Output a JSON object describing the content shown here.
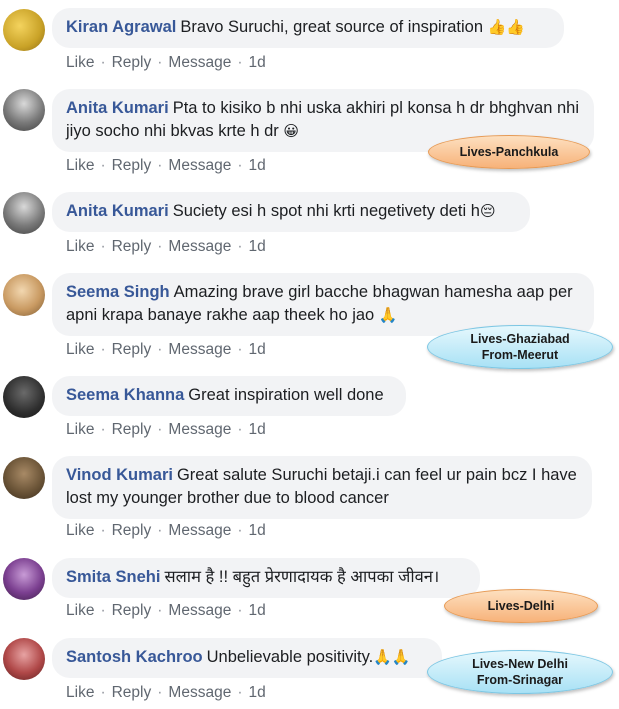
{
  "actions": {
    "like": "Like",
    "reply": "Reply",
    "message": "Message",
    "time": "1d",
    "sep": "·"
  },
  "comments": [
    {
      "author": "Kiran Agrawal",
      "text": "Bravo Suruchi, great source of inspiration",
      "emoji": "👍👍"
    },
    {
      "author": "Anita Kumari",
      "text": "Pta to kisiko b nhi uska akhiri pl konsa h dr bhghvan nhi jiyo socho nhi bkvas krte h dr",
      "emoji": "😀"
    },
    {
      "author": "Anita Kumari",
      "text": "Suciety esi h spot nhi krti negetivety deti h",
      "emoji": "😔"
    },
    {
      "author": "Seema Singh",
      "text": "Amazing brave girl bacche bhagwan hamesha aap per apni krapa banaye rakhe aap theek ho jao",
      "emoji": "🙏"
    },
    {
      "author": "Seema Khanna",
      "text": "Great inspiration well done",
      "emoji": ""
    },
    {
      "author": "Vinod Kumari",
      "text": "Great salute Suruchi betaji.i can feel ur pain bcz I have lost my younger brother due to blood cancer",
      "emoji": ""
    },
    {
      "author": "Smita Snehi",
      "text": "सलाम है !! बहुत प्रेरणादायक है आपका जीवन।",
      "emoji": ""
    },
    {
      "author": "Santosh Kachroo",
      "text": "Unbelievable positivity.",
      "emoji": "🙏🙏"
    }
  ],
  "callouts": {
    "panchkula": {
      "line1": "Lives-Panchkula"
    },
    "ghaziabad": {
      "line1": "Lives-Ghaziabad",
      "line2": "From-Meerut"
    },
    "delhi": {
      "line1": "Lives-Delhi"
    },
    "newdelhi": {
      "line1": "Lives-New Delhi",
      "line2": "From-Srinagar"
    }
  },
  "colors": {
    "author": "#385898",
    "bubble": "#f2f3f5",
    "actions": "#606770"
  }
}
